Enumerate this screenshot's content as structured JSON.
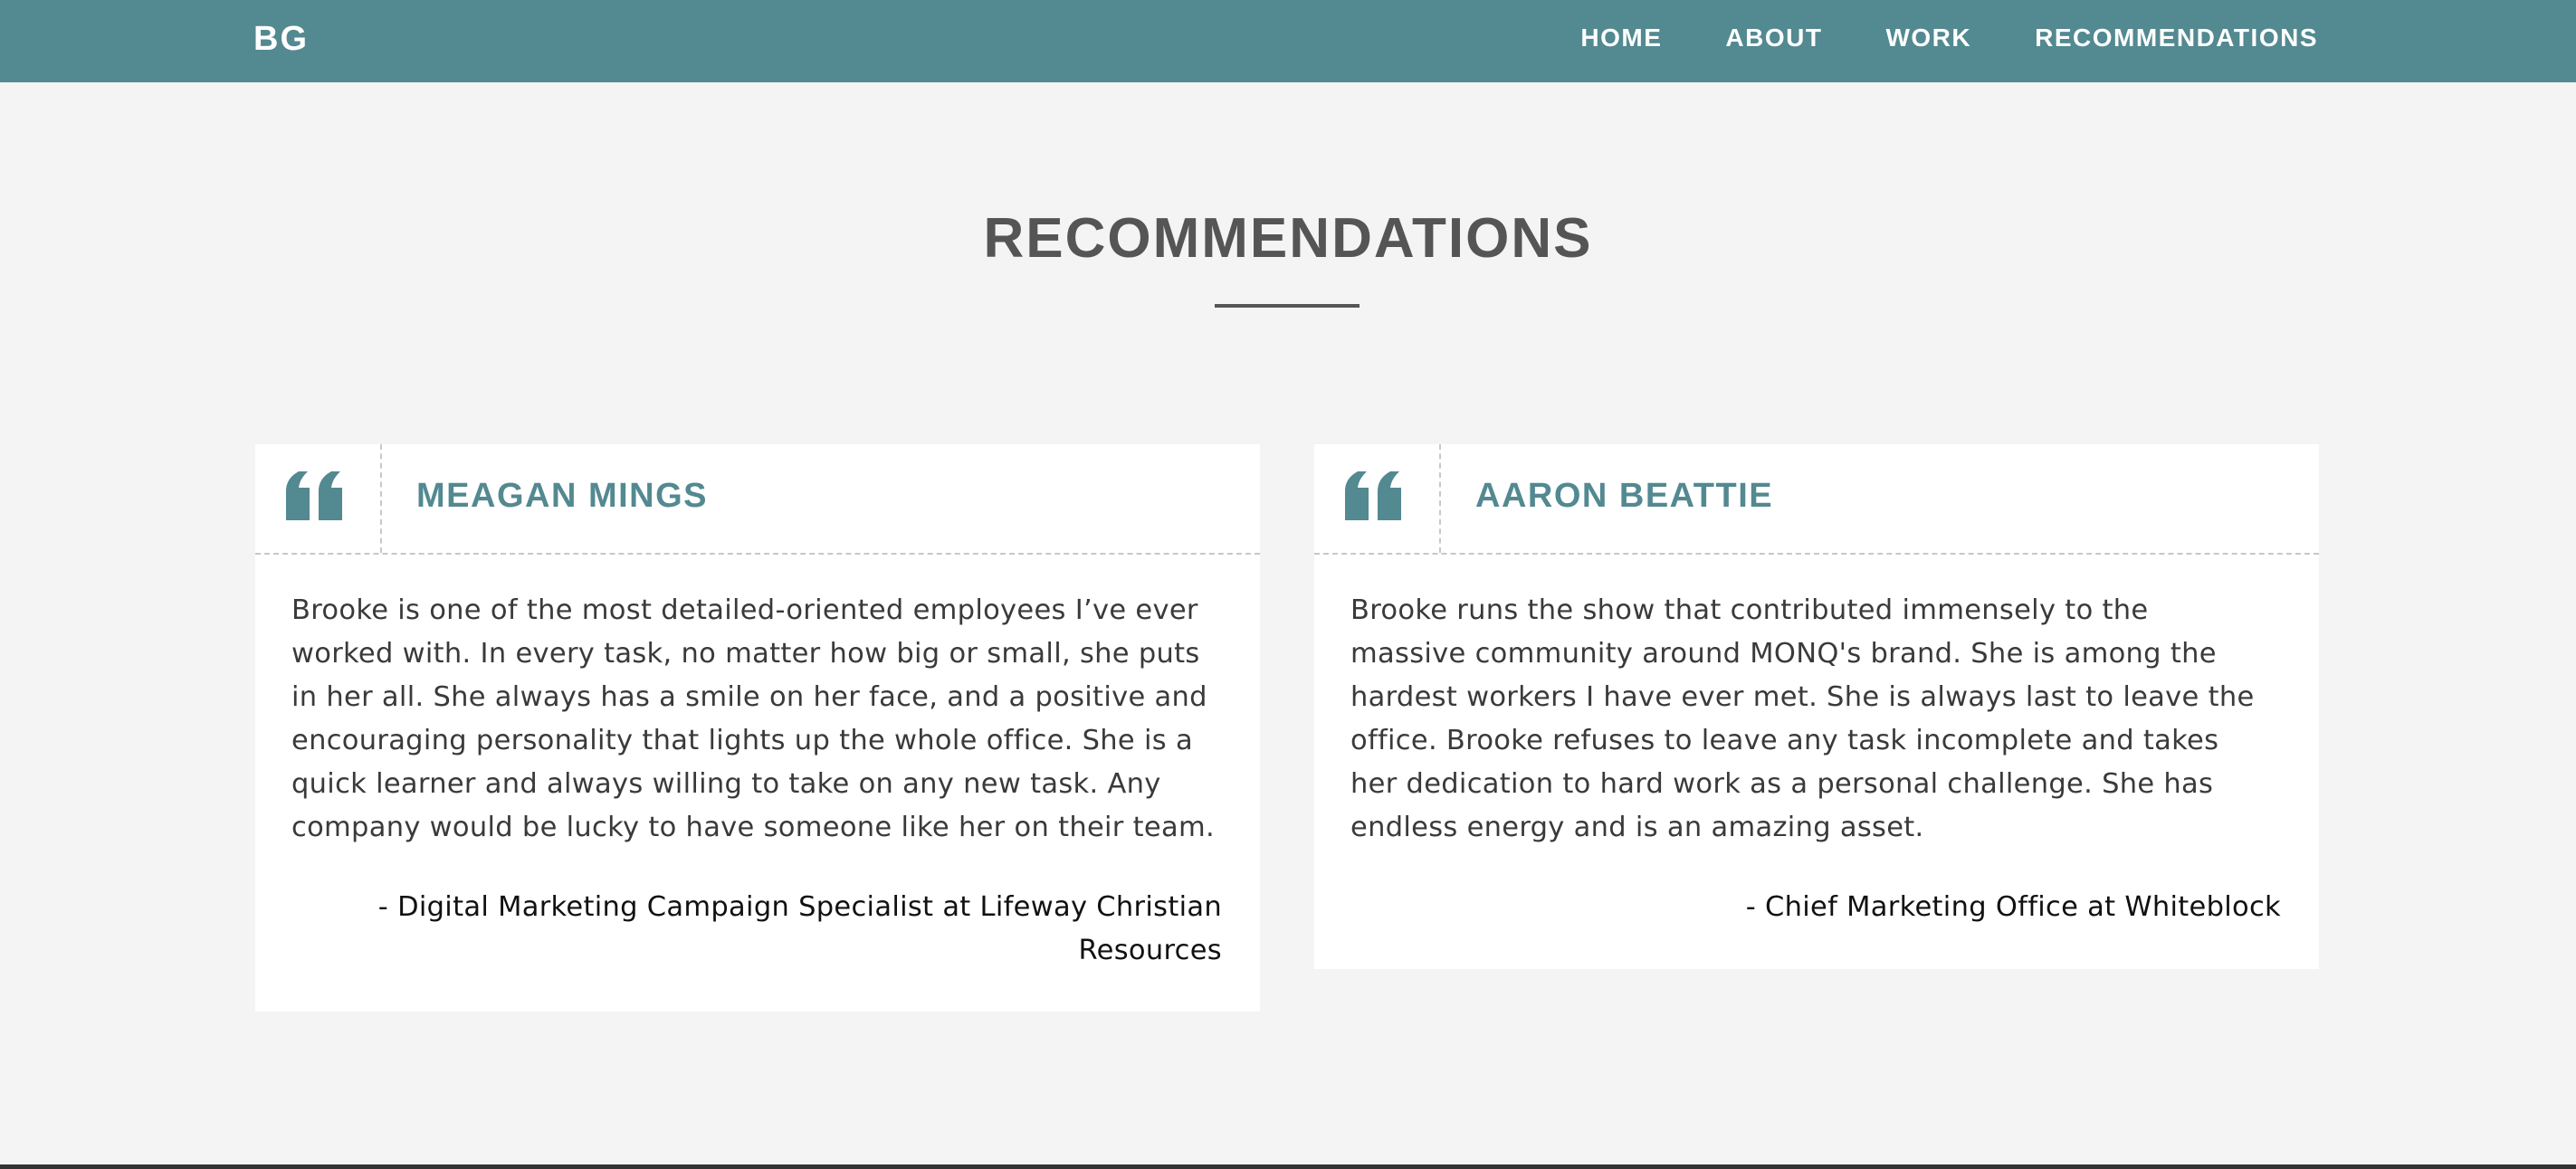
{
  "nav": {
    "brand": "BG",
    "links": [
      "HOME",
      "ABOUT",
      "WORK",
      "RECOMMENDATIONS"
    ]
  },
  "section": {
    "title": "RECOMMENDATIONS"
  },
  "recommendations": [
    {
      "name": "MEAGAN MINGS",
      "text": "Brooke is one of the most detailed-oriented employees I’ve ever worked with. In every task, no matter how big or small, she puts in her all. She always has a smile on her face, and a positive and encouraging personality that lights up the whole office. She is a quick learner and always willing to take on any new task. Any company would be lucky to have someone like her on their team.",
      "attribution": "- Digital Marketing Campaign Specialist at Lifeway Christian Resources"
    },
    {
      "name": "AARON BEATTIE",
      "text": "Brooke runs the show that contributed immensely to the massive community around MONQ's brand. She is among the hardest workers I have ever met. She is always last to leave the office. Brooke refuses to leave any task incomplete and takes her dedication to hard work as a personal challenge. She has endless energy and is an amazing asset.",
      "attribution": "- Chief Marketing Office at Whiteblock"
    }
  ],
  "colors": {
    "accent": "#538991",
    "page_background": "#f4f4f4",
    "card_background": "#ffffff",
    "heading": "#555555"
  },
  "icons": [
    "quote-icon"
  ]
}
